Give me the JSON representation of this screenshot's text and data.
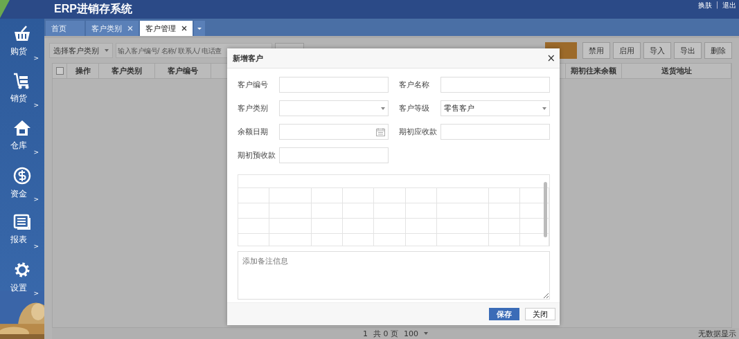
{
  "header": {
    "title": "ERP进销存系统",
    "links": [
      "换肤",
      "退出"
    ],
    "separator": "|"
  },
  "tabs": [
    {
      "label": "首页",
      "selected": false,
      "closable": false
    },
    {
      "label": "客户类别",
      "selected": false,
      "closable": true
    },
    {
      "label": "客户管理",
      "selected": true,
      "closable": true
    }
  ],
  "sidebar": {
    "items": [
      {
        "label": "购货",
        "kind": "basket",
        "arrow": ">"
      },
      {
        "label": "销货",
        "kind": "cart",
        "arrow": ">"
      },
      {
        "label": "仓库",
        "kind": "house",
        "arrow": ">"
      },
      {
        "label": "资金",
        "kind": "dollar",
        "arrow": ">"
      },
      {
        "label": "报表",
        "kind": "report",
        "arrow": ">"
      },
      {
        "label": "设置",
        "kind": "gear",
        "arrow": ">"
      }
    ]
  },
  "toolbar": {
    "category_select": "选择客户类别",
    "search_placeholder": "输入客户编号/ 名称/ 联系人/ 电话查",
    "buttons": [
      "禁用",
      "启用",
      "导入",
      "导出",
      "删除"
    ]
  },
  "table": {
    "select_all_checked": false,
    "columns_left": [
      "操作",
      "客户类别",
      "客户编号"
    ],
    "columns_right": [
      "期初往来余额",
      "送货地址"
    ]
  },
  "dialog": {
    "title": "新增客户",
    "close": "×",
    "fields": [
      {
        "label": "客户编号",
        "kind": "text"
      },
      {
        "label": "客户名称",
        "kind": "text"
      },
      {
        "label": "客户类别",
        "kind": "select"
      },
      {
        "label": "客户等级",
        "kind": "select",
        "value": "零售客户"
      },
      {
        "label": "余额日期",
        "kind": "date"
      },
      {
        "label": "期初应收款",
        "kind": "text"
      },
      {
        "label": "期初预收款",
        "kind": "text"
      }
    ],
    "remark_placeholder": "添加备注信息",
    "buttons": [
      {
        "label": "保存",
        "primary": true
      },
      {
        "label": "关闭",
        "primary": false
      }
    ]
  },
  "pager": {
    "page": "1",
    "total": "共 0 页",
    "size": "100"
  },
  "status": "无数据显示"
}
